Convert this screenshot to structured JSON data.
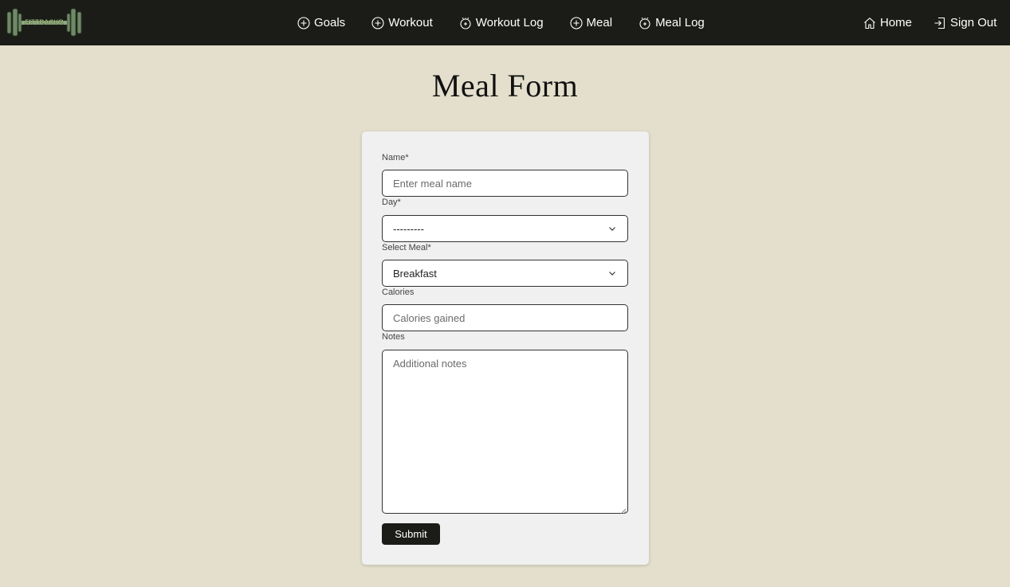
{
  "brand": {
    "logo_text": "FITTRACKR",
    "logo_color": "#b9e08a"
  },
  "nav": {
    "center": [
      {
        "label": "Goals",
        "icon": "plus-circle-icon"
      },
      {
        "label": "Workout",
        "icon": "plus-circle-icon"
      },
      {
        "label": "Workout Log",
        "icon": "log-icon"
      },
      {
        "label": "Meal",
        "icon": "plus-circle-icon"
      },
      {
        "label": "Meal Log",
        "icon": "log-icon"
      }
    ],
    "right": [
      {
        "label": "Home",
        "icon": "home-icon"
      },
      {
        "label": "Sign Out",
        "icon": "sign-out-icon"
      }
    ]
  },
  "page": {
    "title": "Meal Form"
  },
  "form": {
    "name": {
      "label": "Name*",
      "placeholder": "Enter meal name",
      "value": ""
    },
    "day": {
      "label": "Day*",
      "value": "---------"
    },
    "meal": {
      "label": "Select Meal*",
      "value": "Breakfast"
    },
    "calories": {
      "label": "Calories",
      "placeholder": "Calories gained",
      "value": ""
    },
    "notes": {
      "label": "Notes",
      "placeholder": "Additional notes",
      "value": ""
    },
    "submit_label": "Submit"
  },
  "colors": {
    "navbar_bg": "#1b1c17",
    "page_bg": "#e3dfcc",
    "card_bg": "#f0f0f0",
    "button_bg": "#1b1c17"
  }
}
